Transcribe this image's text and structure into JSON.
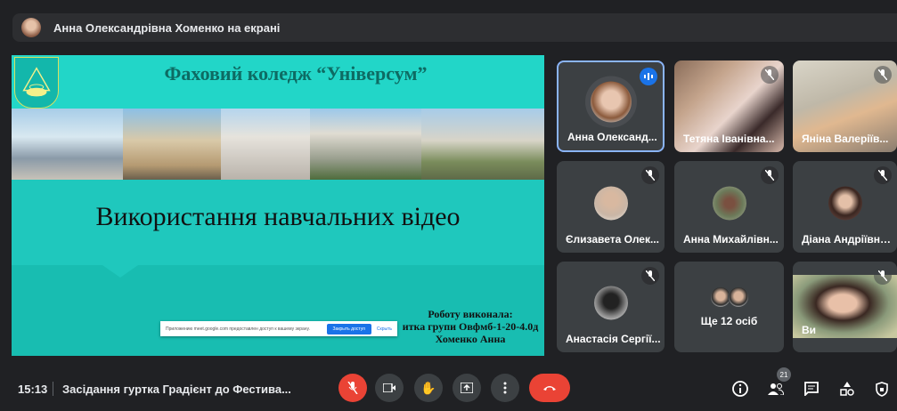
{
  "topbar": {
    "presenting_label": "Анна Олександрівна Хоменко на екрані"
  },
  "slide": {
    "title": "Фаховий коледж “Універсум”",
    "main_title": "Використання навчальних відео",
    "author_lines": [
      "Роботу виконала:",
      "итка групи Овфмб-1-20-4.0д",
      "Хоменко Анна"
    ],
    "share_bar": {
      "message": "Приложению meet.google.com предоставлен доступ к вашему экрану.",
      "stop_label": "Закрыть доступ",
      "hide_label": "Скрыть"
    }
  },
  "participants": [
    {
      "name": "Анна Олександ...",
      "state": "speaking"
    },
    {
      "name": "Тетяна Іванівна...",
      "state": "muted"
    },
    {
      "name": "Яніна Валеріїв...",
      "state": "muted"
    },
    {
      "name": "Єлизавета Олек...",
      "state": "muted"
    },
    {
      "name": "Анна Михайлівн...",
      "state": "muted"
    },
    {
      "name": "Діана Андріївна...",
      "state": "muted"
    },
    {
      "name": "Анастасія Сергії...",
      "state": "muted"
    },
    {
      "name": "Ви",
      "state": "muted"
    }
  ],
  "more_tile": {
    "label": "Ще 12 осіб"
  },
  "bottom": {
    "time": "15:13",
    "meeting_title": "Засідання гуртка Градієнт до Фестива...",
    "participants_count": "21"
  },
  "colors": {
    "end_call": "#ea4335",
    "accent": "#1a73e8",
    "slide_bg": "#1fc8bd"
  }
}
